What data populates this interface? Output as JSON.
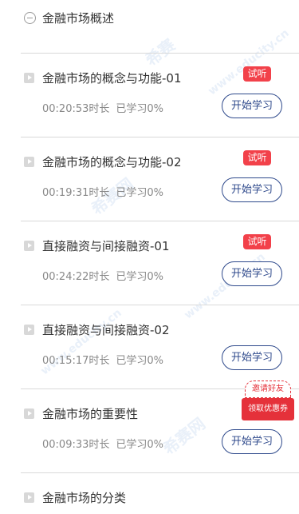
{
  "section": {
    "title": "金融市场概述",
    "collapse_icon": "minus-circle-icon"
  },
  "lessons": [
    {
      "title": "金融市场的概念与功能-01",
      "duration": "00:20:53时长",
      "progress": "已学习0%",
      "trial": "试听",
      "button": "开始学习"
    },
    {
      "title": "金融市场的概念与功能-02",
      "duration": "00:19:31时长",
      "progress": "已学习0%",
      "trial": "试听",
      "button": "开始学习"
    },
    {
      "title": "直接融资与间接融资-01",
      "duration": "00:24:22时长",
      "progress": "已学习0%",
      "trial": "试听",
      "button": "开始学习"
    },
    {
      "title": "直接融资与间接融资-02",
      "duration": "00:15:17时长",
      "progress": "已学习0%",
      "trial": "",
      "button": "开始学习"
    },
    {
      "title": "金融市场的重要性",
      "duration": "00:09:33时长",
      "progress": "已学习0%",
      "trial": "",
      "button": "开始学习"
    },
    {
      "title": "金融市场的分类",
      "duration": "",
      "progress": "",
      "trial": "",
      "button": ""
    }
  ],
  "invite": {
    "top": "邀请好友",
    "bottom": "领取优惠券"
  },
  "watermark": {
    "text1": "希赛",
    "text2": "www.educity.cn",
    "text3": "希赛网"
  },
  "colors": {
    "accent": "#2f4a8c",
    "badge": "#f2414a",
    "invite": "#e5313a"
  }
}
